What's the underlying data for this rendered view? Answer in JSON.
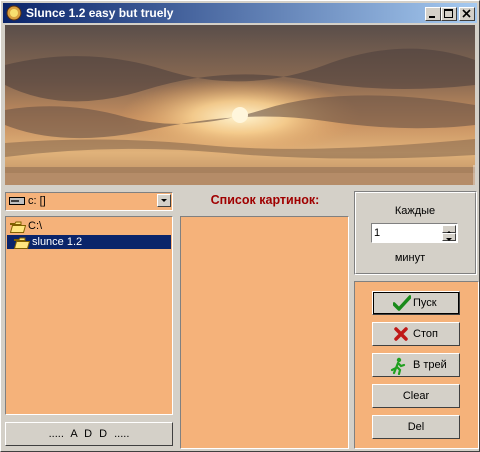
{
  "window": {
    "title": "Slunce 1.2 easy but truely"
  },
  "titlebar_buttons": {
    "minimize": "minimize-icon",
    "maximize": "maximize-icon",
    "close": "close-icon"
  },
  "banner": {
    "icon": "sunset-photo",
    "copyright": "copyright-watermark"
  },
  "drive_select": {
    "value": "c: []"
  },
  "dir_tree": {
    "items": [
      {
        "label": "C:\\",
        "icon": "folder-open-icon"
      },
      {
        "label": "slunce 1.2",
        "icon": "folder-open-icon",
        "selected": true
      }
    ]
  },
  "file_filter_button": {
    "label": "..... A D D ....."
  },
  "picture_list": {
    "title": "Список картинок:",
    "items": []
  },
  "interval": {
    "label": "Каждые",
    "value": "1",
    "unit": "минут"
  },
  "actions": {
    "start": {
      "label": "Пуск",
      "icon": "checkmark-icon"
    },
    "stop": {
      "label": "Стоп",
      "icon": "x-icon"
    },
    "tray": {
      "label": "В трей",
      "icon": "running-man-icon"
    },
    "clear": {
      "label": "Clear"
    },
    "del": {
      "label": "Del"
    }
  },
  "colors": {
    "panel_bg": "#f5b27a",
    "title_accent": "#a00000",
    "titlebar": "#0a246a",
    "selection": "#0a246a"
  }
}
